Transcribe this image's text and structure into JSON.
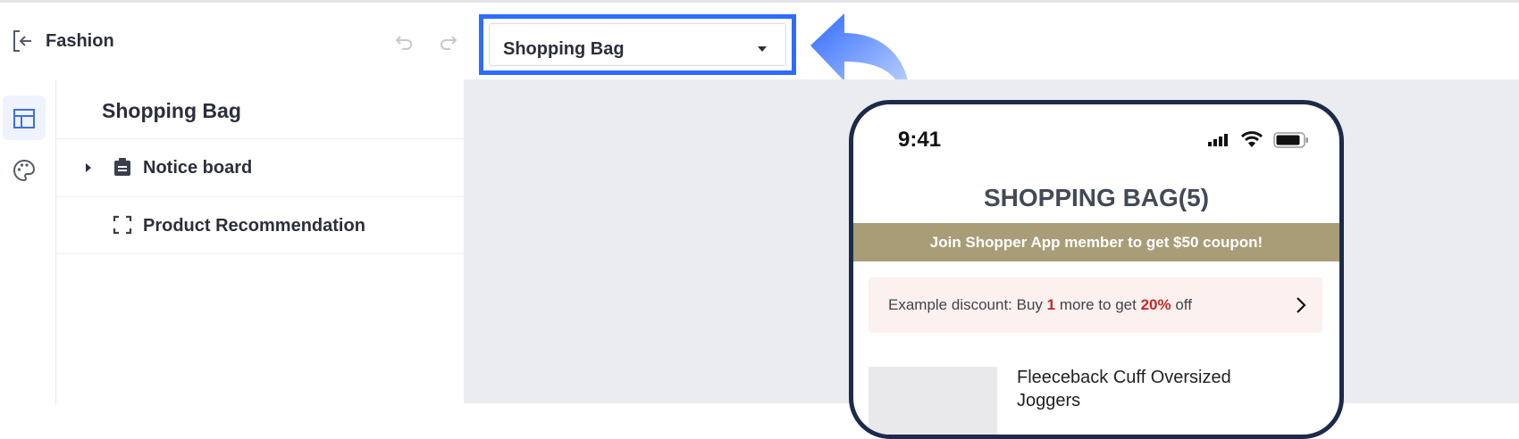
{
  "app": {
    "title": "Fashion"
  },
  "toolbar": {
    "undo_icon": "undo-icon",
    "redo_icon": "redo-icon"
  },
  "page_selector": {
    "value": "Shopping Bag",
    "accent": "#2f6bff"
  },
  "rail": {
    "items": [
      {
        "icon": "layout-icon",
        "active": true
      },
      {
        "icon": "palette-icon",
        "active": false
      }
    ]
  },
  "panel": {
    "title": "Shopping Bag",
    "layers": [
      {
        "label": "Notice board",
        "icon": "clipboard-icon",
        "expandable": true
      },
      {
        "label": "Product Recommendation",
        "icon": "frame-icon",
        "expandable": false
      }
    ]
  },
  "phone": {
    "time": "9:41",
    "title": "SHOPPING BAG(5)",
    "member_banner": "Join Shopper App member to get $50 coupon!",
    "discount": {
      "prefix": "Example discount: Buy ",
      "qty": "1",
      "middle": " more to get ",
      "percent": "20%",
      "suffix": " off"
    },
    "product_name": "Fleeceback Cuff Oversized Joggers",
    "banner_color": "#a99d78"
  }
}
